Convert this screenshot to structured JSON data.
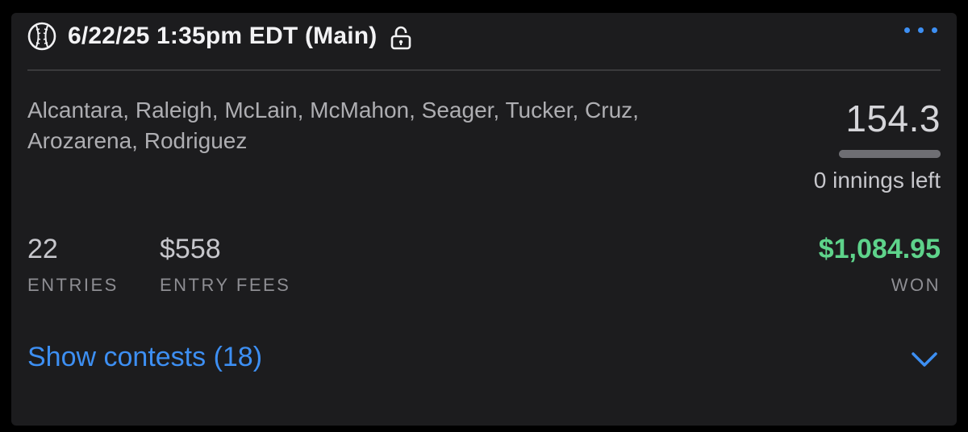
{
  "header": {
    "sport_icon": "baseball-icon",
    "title": "6/22/25 1:35pm EDT (Main)",
    "lock_icon": "unlocked-padlock-icon",
    "more_icon": "ellipsis-icon"
  },
  "lineup": {
    "players": "Alcantara, Raleigh, McLain, McMahon, Seager, Tucker, Cruz, Arozarena, Rodriguez"
  },
  "score": {
    "points": "154.3",
    "progress_fraction": 1.0,
    "remaining": "0 innings left"
  },
  "stats": {
    "entries_value": "22",
    "entries_label": "ENTRIES",
    "fees_value": "$558",
    "fees_label": "ENTRY FEES",
    "won_value": "$1,084.95",
    "won_label": "WON"
  },
  "footer": {
    "show_contests": "Show contests (18)",
    "expand_icon": "chevron-down-icon"
  },
  "colors": {
    "accent": "#3d8ff3",
    "won": "#5ed38b",
    "card": "#1c1c1e",
    "background": "#000000"
  }
}
